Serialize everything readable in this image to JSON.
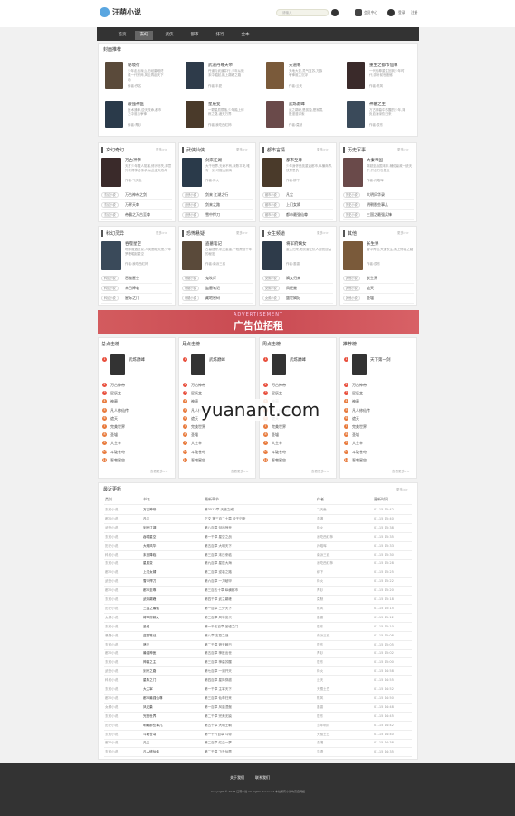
{
  "header": {
    "logo_text": "汪萌小说",
    "search_placeholder": "请输入",
    "user_label": "会员中心",
    "login": "登录",
    "register": "注册"
  },
  "nav": [
    "首页",
    "玄幻",
    "武侠",
    "都市",
    "排行",
    "全本"
  ],
  "recommend": {
    "title": "封面推荐",
    "books": [
      {
        "title": "秘境行",
        "desc": "少年走出深山,历经磨难终成一代宗师,风云再起天下动",
        "meta": "作者:佚名"
      },
      {
        "title": "武道丹尊天帝",
        "desc": "丹道与武道并行,少年从微末中崛起,踏上巅峰之路",
        "meta": "作者:半夏"
      },
      {
        "title": "天道尊",
        "desc": "天地大变,灵气复苏,万族争锋谁主沉浮",
        "meta": "作者:云天"
      },
      {
        "title": "重生之都市仙尊",
        "desc": "一代仙尊重生回到少年时代,弥补前世遗憾",
        "meta": "作者:陈风"
      },
      {
        "title": "最强神医",
        "desc": "医术通神,逆天改命,都市之中谁与争锋",
        "meta": "作者:青衫"
      },
      {
        "title": "星辰变",
        "desc": "一颗星辰陨落,少年踏上修炼之路,诸天万界",
        "meta": "作者:我吃西红柿"
      },
      {
        "title": "武炼巅峰",
        "desc": "武之巅峰,是孤独,是寂寞,是漫漫求索",
        "meta": "作者:莫默"
      },
      {
        "title": "神墓之主",
        "desc": "万古神墓中苏醒的少年,背负血海深仇归来",
        "meta": "作者:辰东"
      }
    ]
  },
  "categories": [
    {
      "title": "玄幻奇幻",
      "more": "更多>>",
      "top": {
        "name": "万古神帝",
        "desc": "天才少年遭人陷害,修为尽失,却意外获得神秘传承,从此逆天改命",
        "meta": "作者:飞天鱼"
      },
      "list": [
        "玄幻小说",
        "玄幻小说",
        "玄幻小说"
      ],
      "items": [
        "万古神帝之剑",
        "万界天尊",
        "帝霸之万古至尊"
      ]
    },
    {
      "title": "武侠仙侠",
      "more": "更多>>",
      "top": {
        "name": "剑来江湖",
        "desc": "大千世界,无奇不有,我陈平安,唯有一剑,可搬山倒海",
        "meta": "作者:烽火"
      },
      "list": [
        "武侠小说",
        "武侠小说",
        "武侠小说"
      ],
      "items": [
        "剑来 江湖之行",
        "剑来之路",
        "雪中悍刀"
      ]
    },
    {
      "title": "都市言情",
      "more": "更多>>",
      "top": {
        "name": "都市至尊",
        "desc": "少年身怀绝技重返都市,纵横商界,快意恩仇",
        "meta": "作者:柳下"
      },
      "list": [
        "都市小说",
        "都市小说",
        "都市小说"
      ],
      "items": [
        "凡尘",
        "上门女婿",
        "都市最强仙尊"
      ]
    },
    {
      "title": "历史军事",
      "more": "更多>>",
      "top": {
        "name": "大秦帝国",
        "desc": "穿越至战国末年,辅佐嬴政一统天下,开创万世基业",
        "meta": "作者:孙皓晖"
      },
      "list": [
        "历史小说",
        "历史小说",
        "历史小说"
      ],
      "items": [
        "大明风华录",
        "明朝那些事儿",
        "三国之最强兵锋"
      ]
    },
    {
      "title": "科幻灵异",
      "more": "更多>>",
      "top": {
        "name": "吞噬星空",
        "desc": "地球遭遇巨变,人类面临灭绝,少年罗峰崛起星空",
        "meta": "作者:我吃西红柿"
      },
      "list": [
        "科幻小说",
        "科幻小说",
        "科幻小说"
      ],
      "items": [
        "吞噬星空",
        "末日降临",
        "星际之门"
      ]
    },
    {
      "title": "恐怖悬疑",
      "more": "更多>>",
      "top": {
        "name": "盗墓笔记",
        "desc": "古墓迷踪,机关重重,一段跨越千年的秘密",
        "meta": "作者:南派三叔"
      },
      "list": [
        "悬疑小说",
        "悬疑小说",
        "悬疑小说"
      ],
      "items": [
        "鬼吹灯",
        "盗墓笔记",
        "藏地密码"
      ]
    },
    {
      "title": "女生频道",
      "more": "更多>>",
      "top": {
        "name": "将军府嫡女",
        "desc": "重生归来,她誓要让仇人血债血偿",
        "meta": "作者:墨香"
      },
      "list": [
        "女频小说",
        "女频小说",
        "女频小说"
      ],
      "items": [
        "嫡女归来",
        "凤还巢",
        "盛世嫡妃"
      ]
    },
    {
      "title": "其他",
      "more": "更多>>",
      "top": {
        "name": "长生界",
        "desc": "雪中青山,大道长生,踏上修真之路",
        "meta": "作者:辰东"
      },
      "list": [
        "其他小说",
        "其他小说",
        "其他小说"
      ],
      "items": [
        "长生界",
        "遮天",
        "圣墟"
      ]
    }
  ],
  "ad": {
    "sub": "ADVERTISEMENT",
    "text": "广告位招租"
  },
  "rankings": [
    {
      "title": "总点击榜",
      "first": "武炼巅峰",
      "items": [
        "万古神帝",
        "星辰变",
        "神墓",
        "凡人修仙传",
        "遮天",
        "完美世界",
        "圣墟",
        "大主宰",
        "斗破苍穹",
        "吞噬星空"
      ],
      "more": "查看更多>>"
    },
    {
      "title": "月点击榜",
      "first": "武炼巅峰",
      "items": [
        "万古神帝",
        "星辰变",
        "神墓",
        "凡人修仙传",
        "遮天",
        "完美世界",
        "圣墟",
        "大主宰",
        "斗破苍穹",
        "吞噬星空"
      ],
      "more": "查看更多>>"
    },
    {
      "title": "周点击榜",
      "first": "武炼巅峰",
      "items": [
        "万古神帝",
        "星辰变",
        "神墓",
        "凡人修仙传",
        "遮天",
        "完美世界",
        "圣墟",
        "大主宰",
        "斗破苍穹",
        "吞噬星空"
      ],
      "more": "查看更多>>"
    },
    {
      "title": "推荐榜",
      "first": "天下第一剑",
      "items": [
        "万古神帝",
        "星辰变",
        "神墓",
        "凡人修仙传",
        "遮天",
        "完美世界",
        "圣墟",
        "大主宰",
        "斗破苍穹",
        "吞噬星空"
      ],
      "more": "查看更多>>"
    }
  ],
  "watermark": "yuanant.com",
  "updates": {
    "title": "最近更新",
    "more": "更多>>",
    "headers": [
      "类别",
      "书名",
      "最新章节",
      "作者",
      "更新时间"
    ],
    "rows": [
      [
        "玄幻小说",
        "万古神帝",
        "第3512章 天道之威",
        "飞天鱼",
        "01-15 15:42"
      ],
      [
        "都市小说",
        "凡尘",
        "正文 第三百二十章 帝王归来",
        "潇湘",
        "01-15 15:40"
      ],
      [
        "武侠小说",
        "剑来江湖",
        "第八百章 剑出惊世",
        "烽火",
        "01-15 15:38"
      ],
      [
        "玄幻小说",
        "吞噬星空",
        "第一千章 星空之战",
        "我吃西红柿",
        "01-15 15:35"
      ],
      [
        "历史小说",
        "大明风华",
        "第五百章 大明天下",
        "孙皓晖",
        "01-15 15:33"
      ],
      [
        "科幻小说",
        "末日降临",
        "第三百章 末日来临",
        "南派三叔",
        "01-15 15:30"
      ],
      [
        "玄幻小说",
        "星辰变",
        "第九百章 星辰大海",
        "我吃西红柿",
        "01-15 15:28"
      ],
      [
        "都市小说",
        "上门女婿",
        "第二百章 逆袭之路",
        "柳下",
        "01-15 15:25"
      ],
      [
        "武侠小说",
        "雪中悍刀",
        "第六百章 一刀破甲",
        "烽火",
        "01-15 15:22"
      ],
      [
        "都市小说",
        "都市至尊",
        "第三百五十章 纵横都市",
        "青衫",
        "01-15 15:20"
      ],
      [
        "玄幻小说",
        "武炼巅峰",
        "第四千章 武之巅峰",
        "莫默",
        "01-15 15:18"
      ],
      [
        "历史小说",
        "三国之最强",
        "第一百章 三分天下",
        "陈风",
        "01-15 15:15"
      ],
      [
        "女频小说",
        "将军府嫡女",
        "第二百章 风华绝代",
        "墨香",
        "01-15 15:12"
      ],
      [
        "玄幻小说",
        "圣墟",
        "第一千五百章 圣墟之门",
        "辰东",
        "01-15 15:10"
      ],
      [
        "悬疑小说",
        "盗墓笔记",
        "第八章 古墓之谜",
        "南派三叔",
        "01-15 15:08"
      ],
      [
        "玄幻小说",
        "遮天",
        "第二千章 遮天蔽日",
        "辰东",
        "01-15 15:05"
      ],
      [
        "都市小说",
        "最强神医",
        "第五百章 神医出世",
        "青衫",
        "01-15 15:02"
      ],
      [
        "玄幻小说",
        "神墓之主",
        "第三百章 神墓苏醒",
        "辰东",
        "01-15 15:00"
      ],
      [
        "武侠小说",
        "剑来之路",
        "第七百章 一剑开天",
        "烽火",
        "01-15 14:58"
      ],
      [
        "科幻小说",
        "星际之门",
        "第四百章 星际穿越",
        "云天",
        "01-15 14:55"
      ],
      [
        "玄幻小说",
        "大主宰",
        "第一千章 主宰天下",
        "天蚕土豆",
        "01-15 14:52"
      ],
      [
        "都市小说",
        "都市最强仙尊",
        "第三百章 仙尊归来",
        "陈风",
        "01-15 14:50"
      ],
      [
        "女频小说",
        "凤还巢",
        "第一百章 凤凰涅槃",
        "墨香",
        "01-15 14:48"
      ],
      [
        "玄幻小说",
        "完美世界",
        "第二千章 完美无缺",
        "辰东",
        "01-15 14:45"
      ],
      [
        "历史小说",
        "明朝那些事儿",
        "第五十章 大明王朝",
        "当年明月",
        "01-15 14:42"
      ],
      [
        "玄幻小说",
        "斗破苍穹",
        "第一千六百章 斗帝",
        "天蚕土豆",
        "01-15 14:40"
      ],
      [
        "都市小说",
        "凡尘",
        "第二百章 红尘一梦",
        "潇湘",
        "01-15 14:38"
      ],
      [
        "玄幻小说",
        "凡人修仙传",
        "第二千章 飞升仙界",
        "忘语",
        "01-15 14:35"
      ]
    ]
  },
  "footer": {
    "links": [
      "关于我们",
      "联系我们"
    ],
    "copyright": "Copyright © 2023 汪萌小说 All Rights Reserved 本站所有小说均来自网络"
  }
}
